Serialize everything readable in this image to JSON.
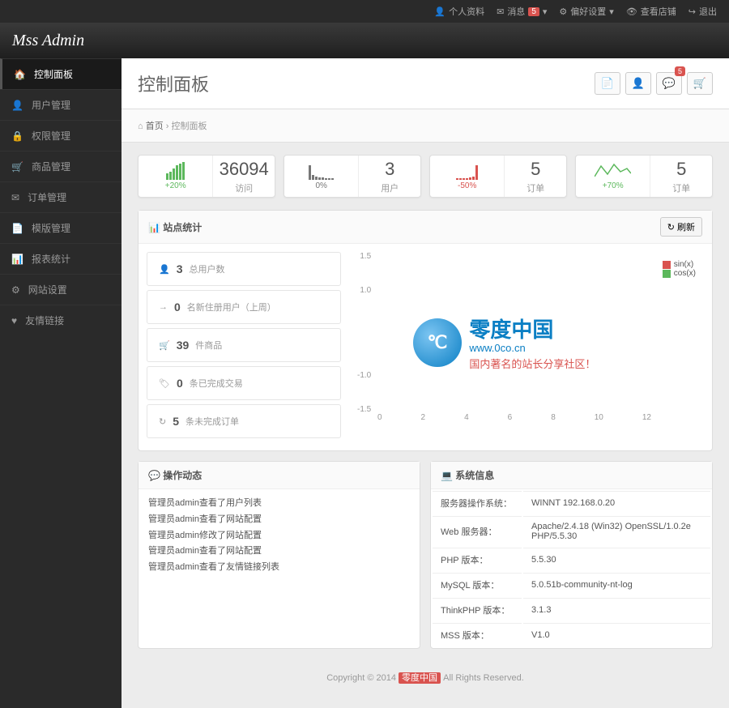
{
  "topbar": {
    "profile": "个人资料",
    "msg": "消息",
    "msg_count": "5",
    "pref": "偏好设置",
    "shop": "查看店铺",
    "logout": "退出"
  },
  "logo": "Mss Admin",
  "sidebar": [
    {
      "icon": "🏠",
      "label": "控制面板",
      "active": true
    },
    {
      "icon": "👤",
      "label": "用户管理"
    },
    {
      "icon": "🔒",
      "label": "权限管理"
    },
    {
      "icon": "🛒",
      "label": "商品管理"
    },
    {
      "icon": "✉",
      "label": "订单管理"
    },
    {
      "icon": "📄",
      "label": "模版管理"
    },
    {
      "icon": "📊",
      "label": "报表统计"
    },
    {
      "icon": "⚙",
      "label": "网站设置"
    },
    {
      "icon": "♥",
      "label": "友情链接"
    }
  ],
  "page_title": "控制面板",
  "title_btns": [
    {
      "icon": "📄",
      "name": "doc-button"
    },
    {
      "icon": "👤",
      "name": "user-button"
    },
    {
      "icon": "💬",
      "name": "msg-button",
      "badge": "5"
    },
    {
      "icon": "🛒",
      "name": "cart-button"
    }
  ],
  "breadcrumb": {
    "home_icon": "⌂",
    "home": "首页",
    "sep": "›",
    "current": "控制面板"
  },
  "stats": [
    {
      "change": "+20%",
      "color": "#5cb85c",
      "value": "36094",
      "label": "访问",
      "bars": [
        8,
        10,
        14,
        18,
        20,
        22
      ]
    },
    {
      "change": "0%",
      "color": "#777",
      "value": "3",
      "label": "用户",
      "bars": [
        18,
        6,
        4,
        3,
        3,
        2,
        2,
        2
      ]
    },
    {
      "change": "-50%",
      "color": "#d9534f",
      "value": "5",
      "label": "订单",
      "bars": [
        2,
        2,
        2,
        2,
        3,
        4,
        18
      ]
    },
    {
      "change": "+70%",
      "color": "#5cb85c",
      "value": "5",
      "label": "订单",
      "line": true
    }
  ],
  "site_stats_title": "站点统计",
  "refresh": "刷新",
  "stat_items": [
    {
      "icon": "👤",
      "num": "3",
      "label": "总用户数"
    },
    {
      "icon": "→",
      "num": "0",
      "label": "名新住册用户（上周）"
    },
    {
      "icon": "🛒",
      "num": "39",
      "label": "件商品"
    },
    {
      "icon": "🏷",
      "num": "0",
      "label": "条已完成交易"
    },
    {
      "icon": "↻",
      "num": "5",
      "label": "条未完成订单"
    }
  ],
  "chart_data": {
    "type": "line",
    "title": "",
    "xlabel": "",
    "ylabel": "",
    "ylim": [
      -1.5,
      1.5
    ],
    "y_ticks": [
      "1.5",
      "1.0",
      "",
      "",
      "-1.0",
      "-1.5"
    ],
    "x_ticks": [
      "0",
      "2",
      "4",
      "6",
      "8",
      "10",
      "12"
    ],
    "series": [
      {
        "name": "sin(x)",
        "color": "#d9534f"
      },
      {
        "name": "cos(x)",
        "color": "#5cb85c"
      }
    ]
  },
  "ops_title": "操作动态",
  "ops_logs": [
    "管理员admin查看了用户列表",
    "管理员admin查看了网站配置",
    "管理员admin修改了网站配置",
    "管理员admin查看了网站配置",
    "管理员admin查看了友情链接列表"
  ],
  "sys_title": "系统信息",
  "sys_info": [
    {
      "k": "服务器操作系统：",
      "v": "WINNT 192.168.0.20"
    },
    {
      "k": "Web 服务器：",
      "v": "Apache/2.4.18 (Win32) OpenSSL/1.0.2e PHP/5.5.30"
    },
    {
      "k": "PHP 版本：",
      "v": "5.5.30"
    },
    {
      "k": "MySQL 版本：",
      "v": "5.0.51b-community-nt-log"
    },
    {
      "k": "ThinkPHP 版本：",
      "v": "3.1.3"
    },
    {
      "k": "MSS 版本：",
      "v": "V1.0"
    }
  ],
  "footer": {
    "pre": "Copyright © 2014 ",
    "brand": "零度中国",
    "post": " All Rights Reserved."
  },
  "watermark": {
    "circle": "℃",
    "title": "零度中国",
    "url": "www.0co.cn",
    "sub": "国内著名的站长分享社区！"
  }
}
